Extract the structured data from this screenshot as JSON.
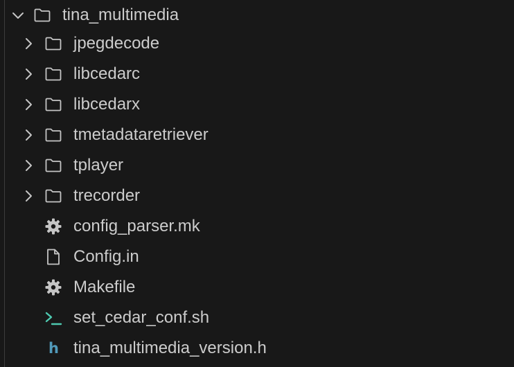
{
  "explorer": {
    "root": {
      "label": "tina_multimedia",
      "icon": "folder-icon",
      "expanded": true
    },
    "folders": [
      {
        "label": "jpegdecode",
        "icon": "folder-icon"
      },
      {
        "label": "libcedarc",
        "icon": "folder-icon"
      },
      {
        "label": "libcedarx",
        "icon": "folder-icon"
      },
      {
        "label": "tmetadataretriever",
        "icon": "folder-icon"
      },
      {
        "label": "tplayer",
        "icon": "folder-icon"
      },
      {
        "label": "trecorder",
        "icon": "folder-icon"
      }
    ],
    "files": [
      {
        "label": "config_parser.mk",
        "icon": "gear-icon"
      },
      {
        "label": "Config.in",
        "icon": "file-icon"
      },
      {
        "label": "Makefile",
        "icon": "gear-icon"
      },
      {
        "label": "set_cedar_conf.sh",
        "icon": "terminal-icon"
      },
      {
        "label": "tina_multimedia_version.h",
        "icon": "h-header-icon",
        "glyph": "h"
      }
    ]
  },
  "colors": {
    "background": "#181818",
    "text": "#cccccc",
    "icon": "#c5c5c5",
    "terminal_icon": "#4ec9b0",
    "header_icon": "#519aba",
    "indent_guide": "#3c3c3c"
  }
}
